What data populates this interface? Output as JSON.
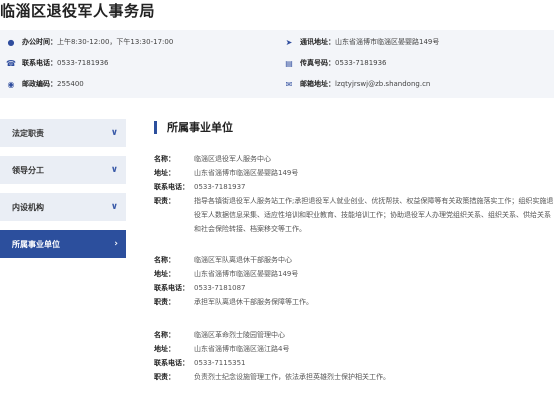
{
  "page_title": "临淄区退役军人事务局",
  "info": {
    "office_hours": {
      "label": "办公时间：",
      "value": "上午8:30-12:00，下午13:30-17:00"
    },
    "address": {
      "label": "通讯地址：",
      "value": "山东省淄博市临淄区晏婴路149号"
    },
    "phone": {
      "label": "联系电话：",
      "value": "0533-7181936"
    },
    "fax": {
      "label": "传真号码：",
      "value": "0533-7181936"
    },
    "postcode": {
      "label": "邮政编码：",
      "value": "255400"
    },
    "email": {
      "label": "邮箱地址：",
      "value": "lzqtyjrswj@zb.shandong.cn"
    }
  },
  "sidebar": {
    "items": [
      {
        "label": "法定职责"
      },
      {
        "label": "领导分工"
      },
      {
        "label": "内设机构"
      },
      {
        "label": "所属事业单位"
      }
    ]
  },
  "section_title": "所属事业单位",
  "labels": {
    "name": "名称：",
    "address": "地址：",
    "phone": "联系电话：",
    "duty": "职责："
  },
  "units": [
    {
      "name": "临淄区退役军人服务中心",
      "address": "山东省淄博市临淄区晏婴路149号",
      "phone": "0533-7181937",
      "duty": "指导各镇街退役军人服务站工作;承担退役军人就业创业、优抚帮扶、权益保障等有关政策措施落实工作；组织实施退役军人数据信息采集、适应性培训和职业教育、技能培训工作；协助退役军人办理党组织关系、组织关系、供给关系和社会保险转接、档案移交等工作。"
    },
    {
      "name": "临淄区军队离退休干部服务中心",
      "address": "山东省淄博市临淄区晏婴路149号",
      "phone": "0533-7181087",
      "duty": "承担军队离退休干部服务保障等工作。"
    },
    {
      "name": "临淄区革命烈士陵园管理中心",
      "address": "山东省淄博市临淄区淄江路4号",
      "phone": "0533-7115351",
      "duty": "负责烈士纪念设施管理工作，依法承担英雄烈士保护相关工作。"
    }
  ]
}
